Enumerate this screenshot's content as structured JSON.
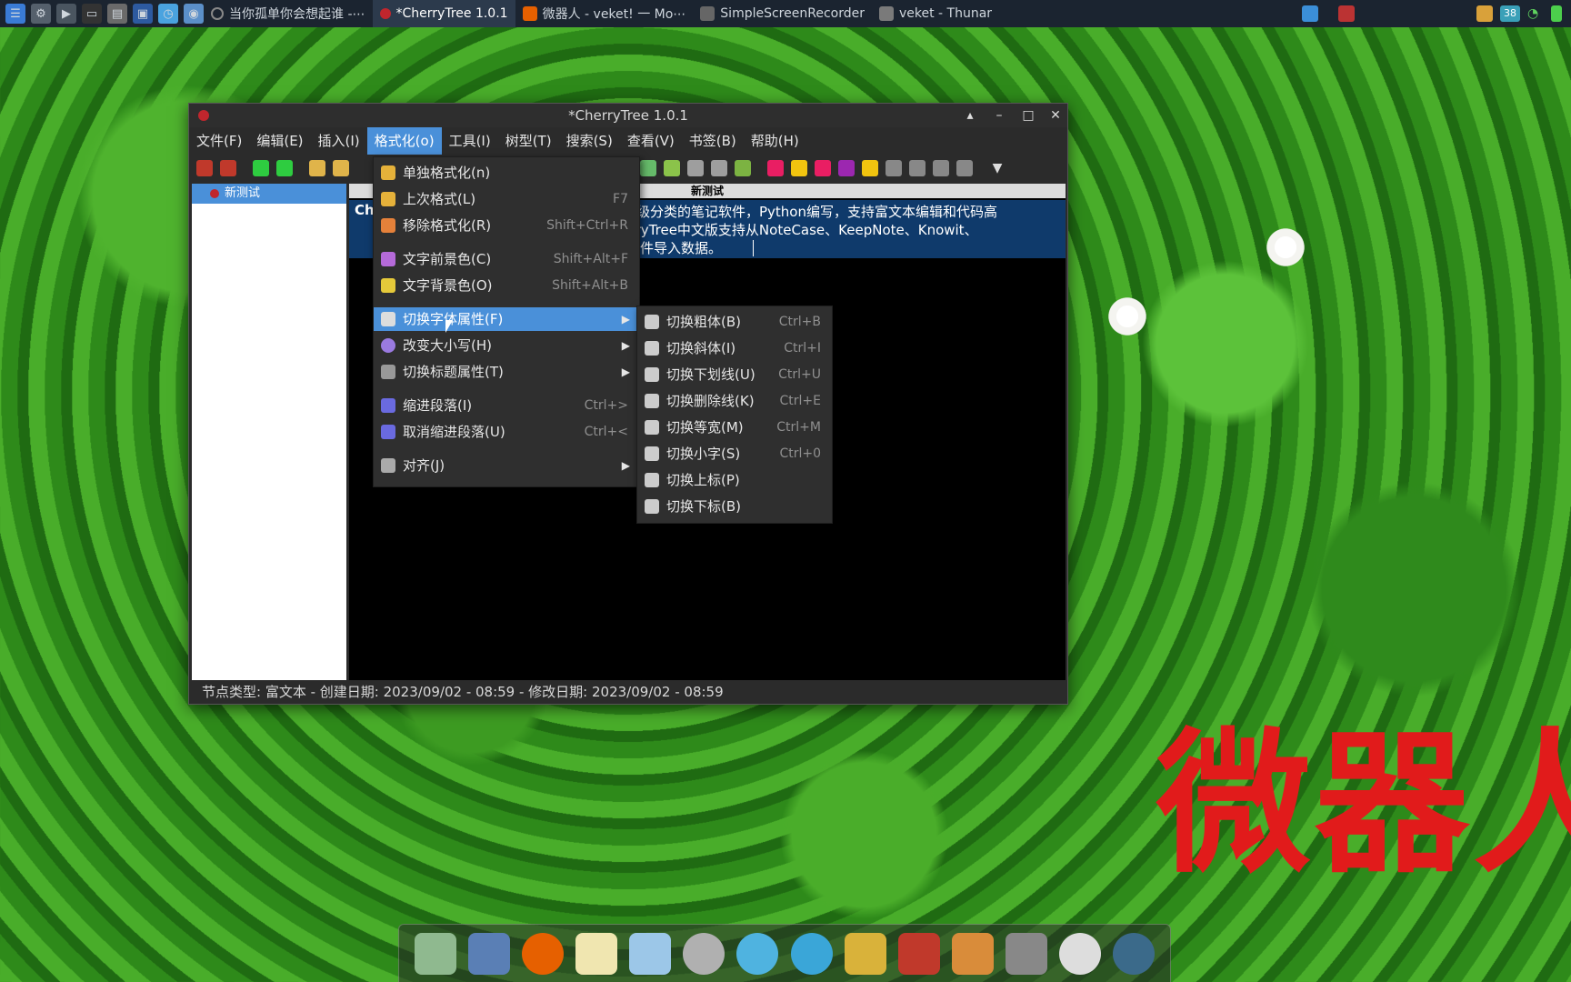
{
  "taskbar": {
    "tasks": [
      {
        "label": "当你孤单你会想起谁 -⋯",
        "active": false
      },
      {
        "label": "*CherryTree 1.0.1",
        "active": true
      },
      {
        "label": "微器人 - veket! 一 Mo⋯",
        "active": false
      },
      {
        "label": "SimpleScreenRecorder",
        "active": false
      },
      {
        "label": "veket - Thunar",
        "active": false
      }
    ],
    "tray_badge": "38"
  },
  "window": {
    "title": "*CherryTree 1.0.1",
    "menus": [
      "文件(F)",
      "编辑(E)",
      "插入(I)",
      "格式化(o)",
      "工具(I)",
      "树型(T)",
      "搜索(S)",
      "查看(V)",
      "书签(B)",
      "帮助(H)"
    ],
    "tree_node": "新测试",
    "editor_header": "新测试",
    "editor_lines": [
      "Ch",
      "具层级分类的笔记软件，Python编写，支持富文本编辑和代码高",
      "herryTree中文版支持从NoteCase、KeepNote、Knowit、",
      "也软件导入数据。"
    ],
    "status": "节点类型: 富文本  -  创建日期: 2023/09/02 - 08:59  -  修改日期: 2023/09/02 - 08:59"
  },
  "format_menu": {
    "items": [
      {
        "label": "单独格式化(n)",
        "key": ""
      },
      {
        "label": "上次格式(L)",
        "key": "F7"
      },
      {
        "label": "移除格式化(R)",
        "key": "Shift+Ctrl+R"
      },
      {
        "label": "文字前景色(C)",
        "key": "Shift+Alt+F"
      },
      {
        "label": "文字背景色(O)",
        "key": "Shift+Alt+B"
      },
      {
        "label": "切换字体属性(F)",
        "key": ""
      },
      {
        "label": "改变大小写(H)",
        "key": ""
      },
      {
        "label": "切换标题属性(T)",
        "key": ""
      },
      {
        "label": "缩进段落(I)",
        "key": "Ctrl+>"
      },
      {
        "label": "取消缩进段落(U)",
        "key": "Ctrl+<"
      },
      {
        "label": "对齐(J)",
        "key": ""
      }
    ]
  },
  "font_submenu": {
    "items": [
      {
        "label": "切换粗体(B)",
        "key": "Ctrl+B"
      },
      {
        "label": "切换斜体(I)",
        "key": "Ctrl+I"
      },
      {
        "label": "切换下划线(U)",
        "key": "Ctrl+U"
      },
      {
        "label": "切换删除线(K)",
        "key": "Ctrl+E"
      },
      {
        "label": "切换等宽(M)",
        "key": "Ctrl+M"
      },
      {
        "label": "切换小字(S)",
        "key": "Ctrl+0"
      },
      {
        "label": "切换上标(P)",
        "key": ""
      },
      {
        "label": "切换下标(B)",
        "key": ""
      }
    ]
  },
  "watermark": "微器人"
}
